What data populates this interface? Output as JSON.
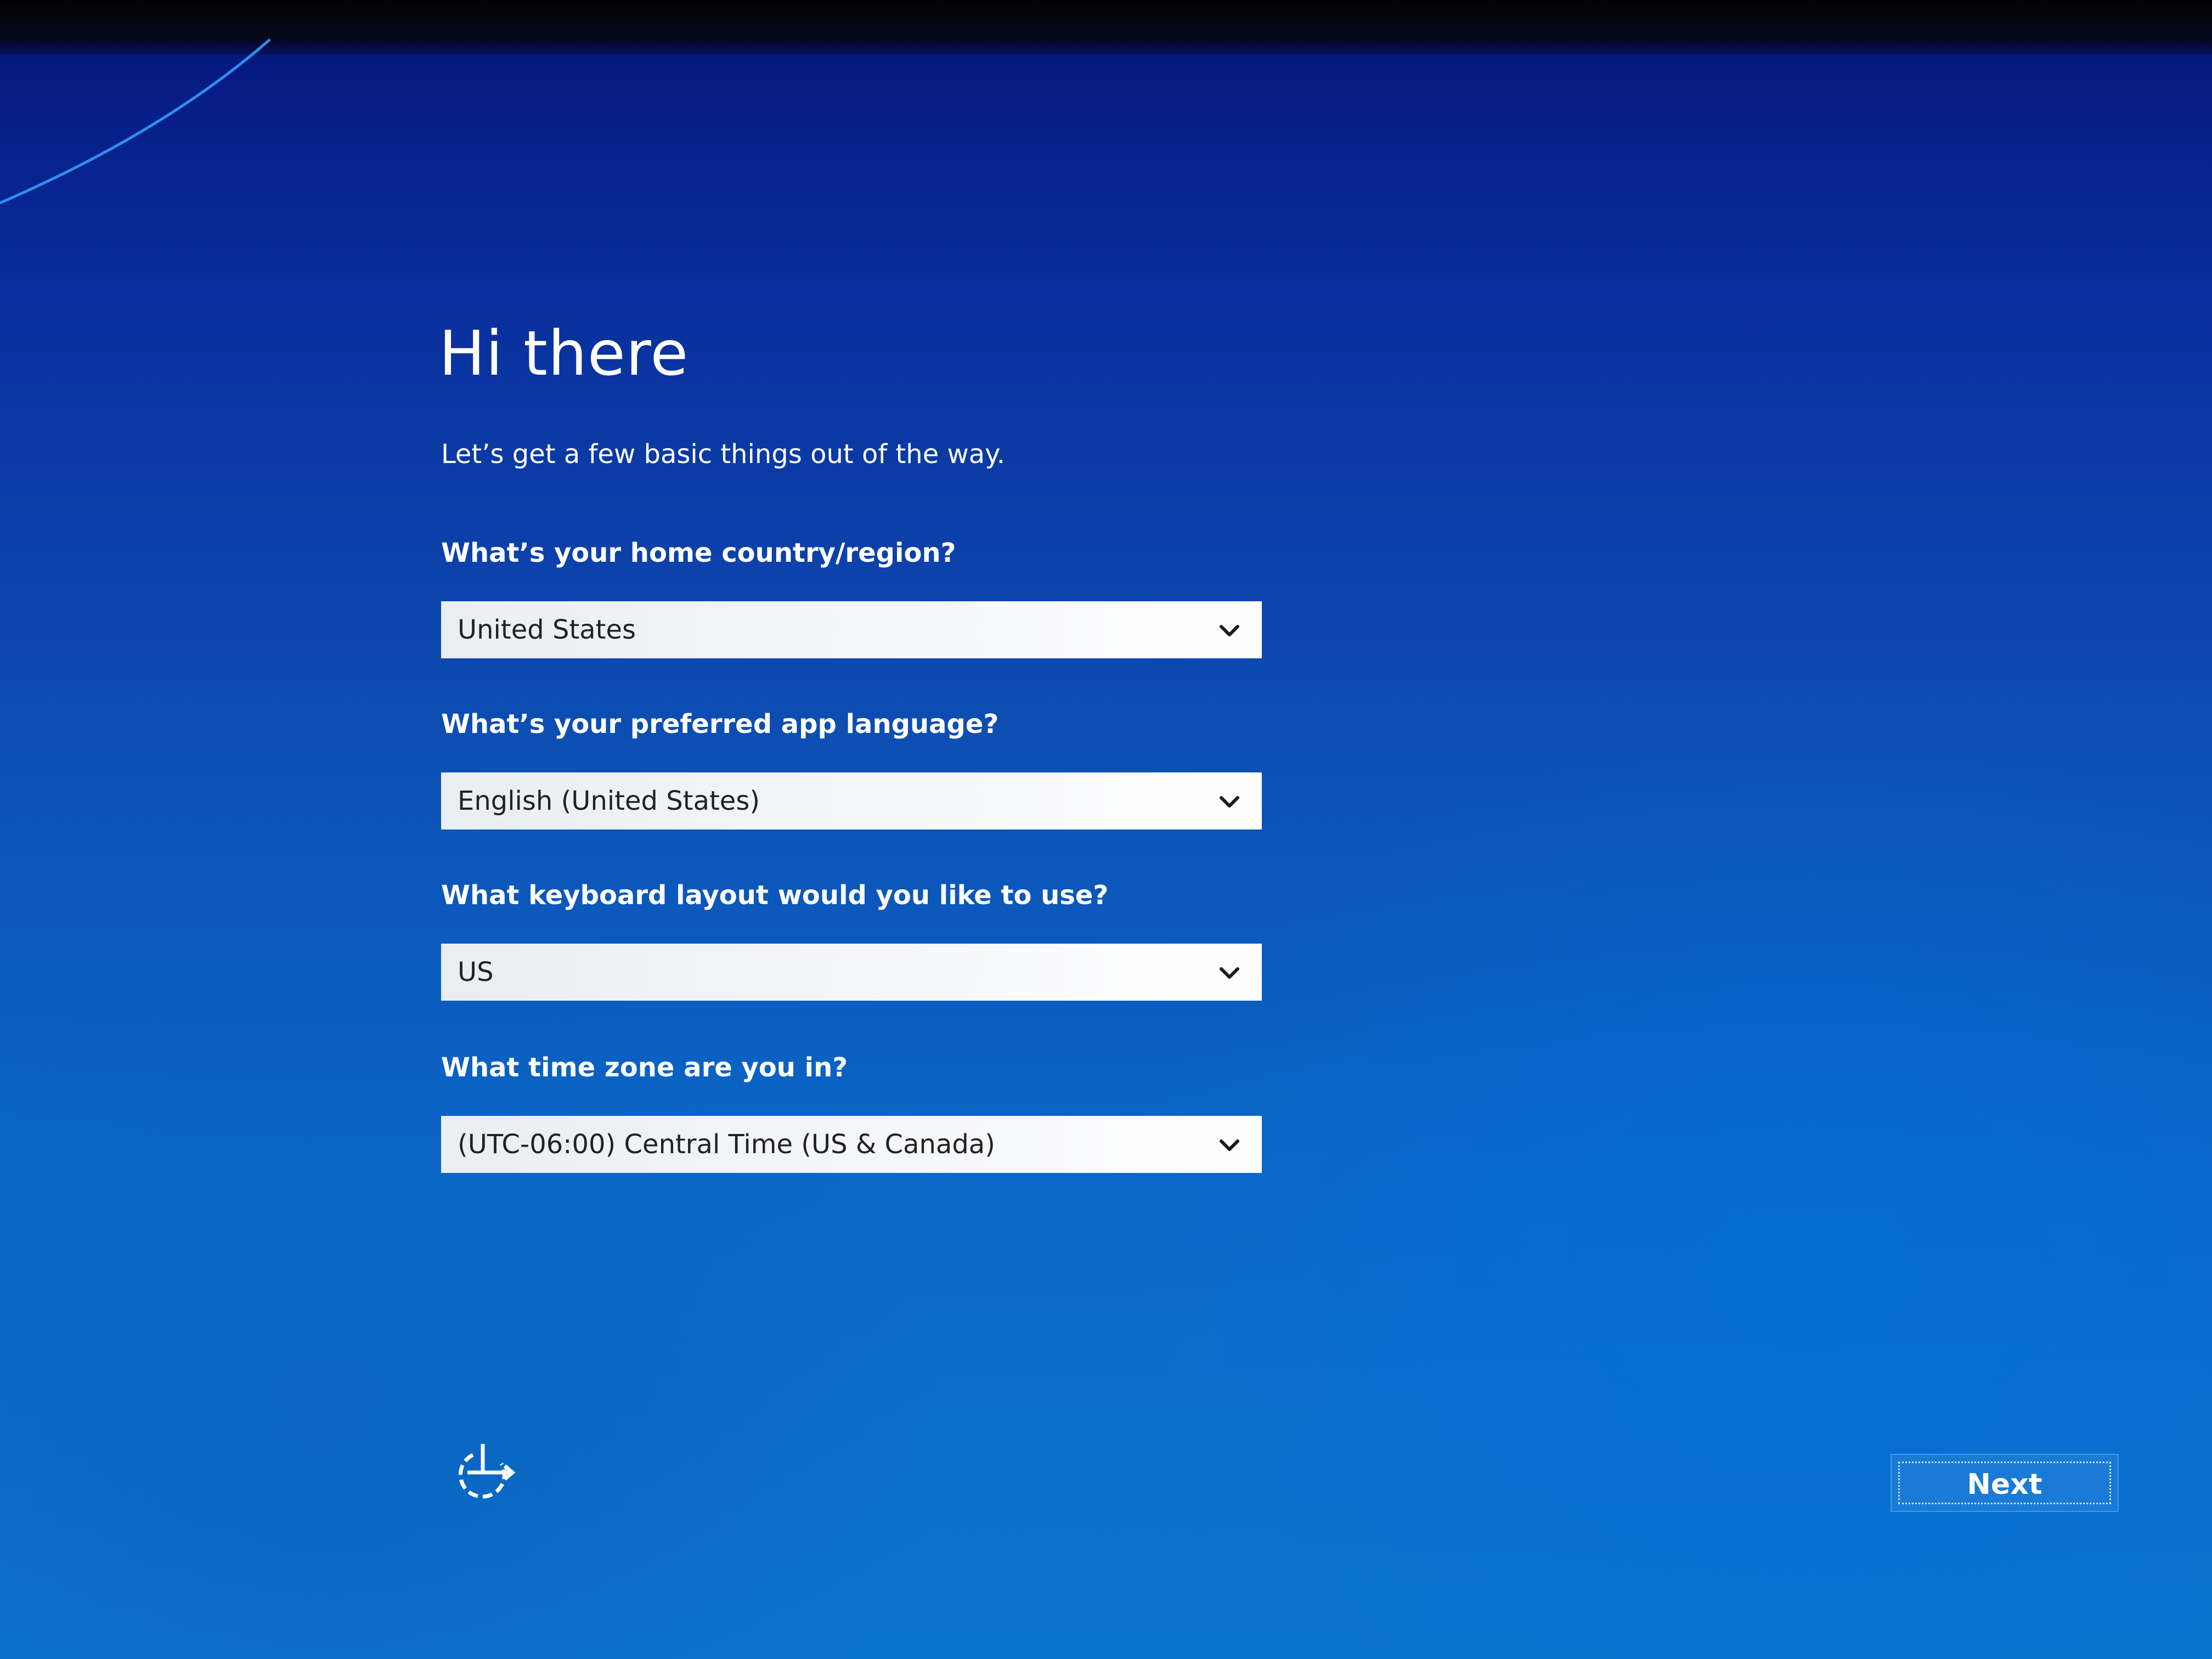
{
  "screen": {
    "title": "Hi there",
    "subtitle": "Let’s get a few basic things out of the way."
  },
  "fields": [
    {
      "question": "What’s your home country/region?",
      "value": "United States"
    },
    {
      "question": "What’s your preferred app language?",
      "value": "English (United States)"
    },
    {
      "question": "What keyboard layout would you like to use?",
      "value": "US"
    },
    {
      "question": "What time zone are you in?",
      "value": "(UTC-06:00) Central Time (US & Canada)"
    }
  ],
  "footer": {
    "accessibility_icon": "ease-of-access-icon",
    "next_label": "Next"
  },
  "colors": {
    "background_top": "#03147a",
    "background_bottom": "#0b74cf",
    "button": "#1a7ad6",
    "text": "#ffffff"
  }
}
